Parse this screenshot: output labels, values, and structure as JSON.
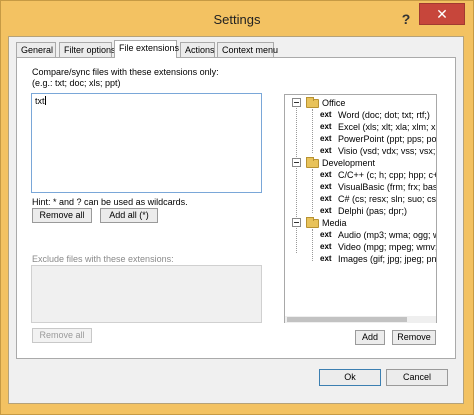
{
  "window": {
    "title": "Settings",
    "help_glyph": "?",
    "close_glyph": "✕"
  },
  "tabs": [
    {
      "label": "General"
    },
    {
      "label": "Filter options"
    },
    {
      "label": "File extensions"
    },
    {
      "label": "Actions"
    },
    {
      "label": "Context menu"
    }
  ],
  "compare": {
    "label_line1": "Compare/sync files with these extensions only:",
    "label_line2": "(e.g.: txt; doc; xls; ppt)",
    "value": "txt",
    "hint": "Hint: * and ? can be used as wildcards.",
    "remove_all": "Remove all",
    "add_all": "Add all (*)"
  },
  "exclude": {
    "label": "Exclude files with these extensions:",
    "value": "",
    "remove_all": "Remove all"
  },
  "tree": {
    "groups": [
      {
        "name": "Office",
        "items": [
          {
            "icon": "ext",
            "label": "Word (doc; dot; txt; rtf;)"
          },
          {
            "icon": "ext",
            "label": "Excel (xls; xlt; xla; xlm; xlc; ;"
          },
          {
            "icon": "ext",
            "label": "PowerPoint (ppt; pps; pot; p"
          },
          {
            "icon": "ext",
            "label": "Visio (vsd; vdx; vss; vsx; vs"
          }
        ]
      },
      {
        "name": "Development",
        "items": [
          {
            "icon": "ext",
            "label": "C/C++ (c; h; cpp; hpp; c++;"
          },
          {
            "icon": "ext",
            "label": "VisualBasic (frm; frx; bas; c"
          },
          {
            "icon": "ext",
            "label": "C# (cs; resx; sln; suo; cspn"
          },
          {
            "icon": "ext",
            "label": "Delphi (pas; dpr;)"
          }
        ]
      },
      {
        "name": "Media",
        "items": [
          {
            "icon": "ext",
            "label": "Audio (mp3; wma; ogg; wa"
          },
          {
            "icon": "ext",
            "label": "Video (mpg; mpeg; wmv; o"
          },
          {
            "icon": "ext",
            "label": "Images (gif; jpg; jpeg; png;"
          }
        ]
      }
    ],
    "add": "Add",
    "remove": "Remove"
  },
  "footer": {
    "ok": "Ok",
    "cancel": "Cancel"
  }
}
